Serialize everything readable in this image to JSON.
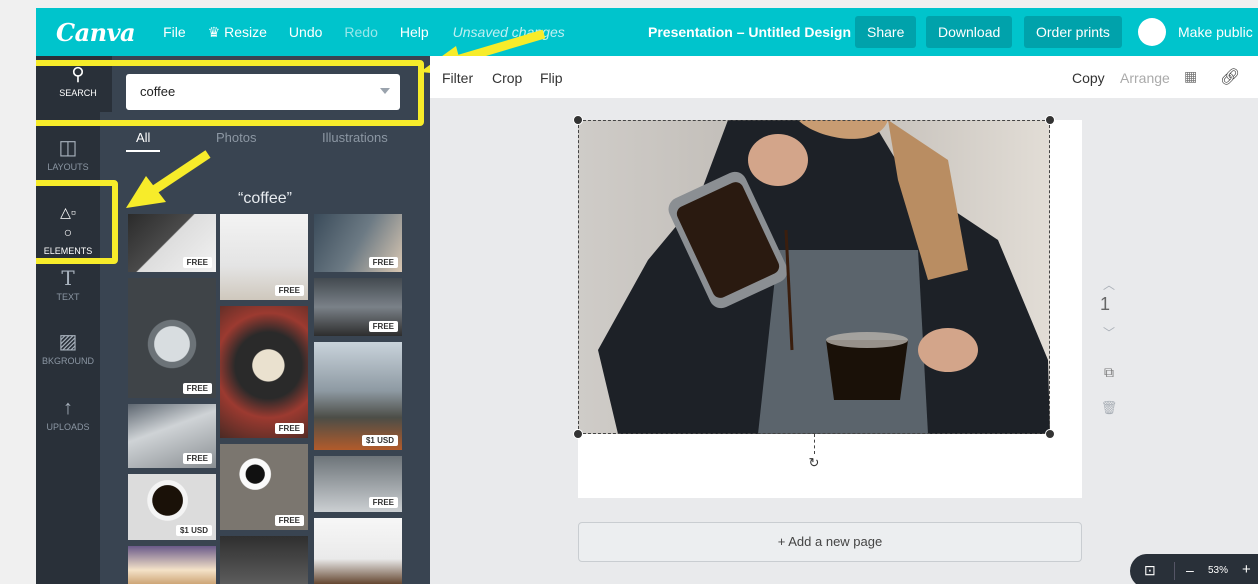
{
  "topbar": {
    "logo": "Canva",
    "menu": [
      "File",
      "Resize",
      "Undo",
      "Redo",
      "Help"
    ],
    "resize_icon": "crown-icon",
    "unsaved": "Unsaved changes",
    "doc_title": "Presentation – Untitled Design",
    "share": "Share",
    "download": "Download",
    "order_prints": "Order prints",
    "make_public": "Make public",
    "accent": "#00c4cc"
  },
  "sidebar": {
    "items": [
      {
        "label": "SEARCH",
        "icon": "search-icon"
      },
      {
        "label": "LAYOUTS",
        "icon": "layouts-icon"
      },
      {
        "label": "ELEMENTS",
        "icon": "shapes-icon"
      },
      {
        "label": "TEXT",
        "icon": "text-icon"
      },
      {
        "label": "BKGROUND",
        "icon": "background-icon"
      },
      {
        "label": "UPLOADS",
        "icon": "upload-icon"
      }
    ]
  },
  "panel": {
    "search_value": "coffee",
    "tabs": [
      "All",
      "Photos",
      "Illustrations"
    ],
    "query_title": "“coffee”",
    "badges": {
      "free": "FREE",
      "paid": "$1 USD"
    }
  },
  "toolbar": {
    "filter": "Filter",
    "crop": "Crop",
    "flip": "Flip",
    "copy": "Copy",
    "arrange": "Arrange"
  },
  "canvas": {
    "page_number": "1",
    "add_page": "+ Add a new page"
  },
  "zoom": {
    "value": "53%",
    "minus": "–",
    "plus": "+"
  },
  "colors": {
    "highlight": "#f7ec2a",
    "panel": "#394451",
    "nav": "#293039"
  }
}
